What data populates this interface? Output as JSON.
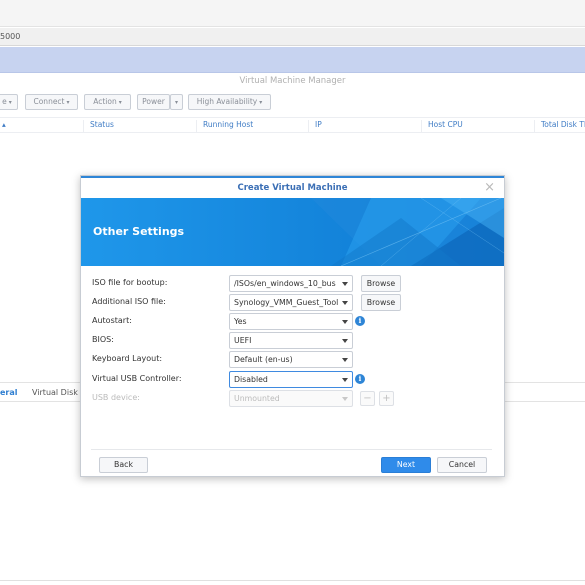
{
  "browser": {
    "address_fragment": "5000"
  },
  "app": {
    "title": "Virtual Machine Manager",
    "toolbar": [
      {
        "label": "e",
        "has_caret": true
      },
      {
        "label": "Connect",
        "has_caret": true
      },
      {
        "label": "Action",
        "has_caret": true
      },
      {
        "label": "Power",
        "has_caret": true
      },
      {
        "label": "High Availability",
        "has_caret": true
      }
    ],
    "columns": [
      "Status",
      "Running Host",
      "IP",
      "Host CPU",
      "Total Disk Th"
    ],
    "bottom_tabs": [
      {
        "label": "eral",
        "active": true
      },
      {
        "label": "Virtual Disk",
        "active": false
      }
    ]
  },
  "dialog": {
    "title": "Create Virtual Machine",
    "close_glyph": "×",
    "banner_title": "Other Settings",
    "rows": {
      "iso_bootup": {
        "label": "ISO file for bootup:",
        "value": "/ISOs/en_windows_10_bus",
        "button": "Browse"
      },
      "additional_iso": {
        "label": "Additional ISO file:",
        "value": "Synology_VMM_Guest_Tool",
        "button": "Browse"
      },
      "autostart": {
        "label": "Autostart:",
        "value": "Yes",
        "info": "i"
      },
      "bios": {
        "label": "BIOS:",
        "value": "UEFI"
      },
      "keyboard_layout": {
        "label": "Keyboard Layout:",
        "value": "Default (en-us)"
      },
      "usb_controller": {
        "label": "Virtual USB Controller:",
        "value": "Disabled",
        "info": "i"
      },
      "usb_device": {
        "label": "USB device:",
        "value": "Unmounted",
        "minus": "−",
        "plus": "+"
      }
    },
    "footer": {
      "back": "Back",
      "next": "Next",
      "cancel": "Cancel"
    }
  },
  "colors": {
    "accent_blue": "#2f8bea",
    "banner_blue": "#1a8fe3",
    "title_blue": "#3b6fb5",
    "column_header_blue": "#3f7cc5",
    "top_band": "#c7d3f0"
  }
}
